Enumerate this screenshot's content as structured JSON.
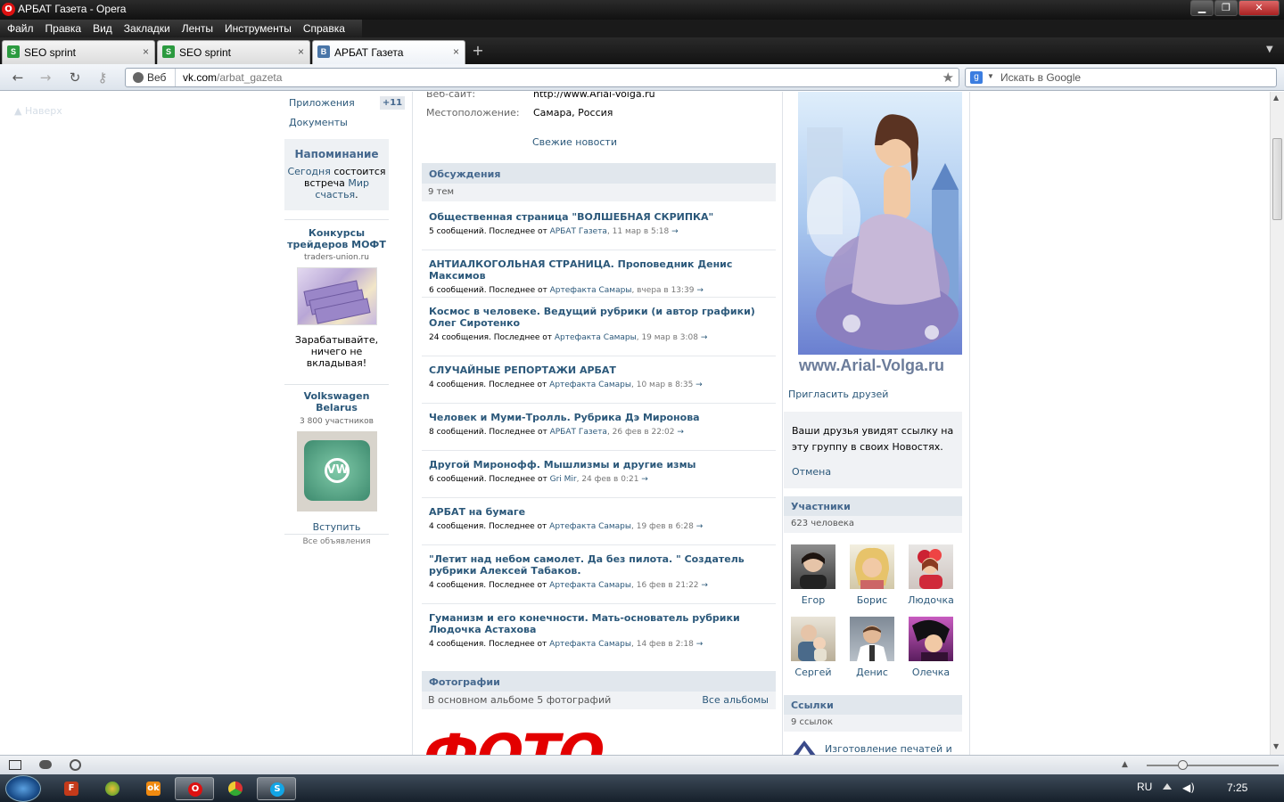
{
  "window": {
    "title": "АРБАТ Газета - Opera",
    "minimize": "▁",
    "maximize": "❐",
    "close": "✕"
  },
  "menu": [
    "Файл",
    "Правка",
    "Вид",
    "Закладки",
    "Ленты",
    "Инструменты",
    "Справка"
  ],
  "tabs": [
    {
      "label": "SEO sprint",
      "icon": "S",
      "color": "#2b9a3f"
    },
    {
      "label": "SEO sprint",
      "icon": "S",
      "color": "#2b9a3f"
    },
    {
      "label": "АРБАТ Газета",
      "icon": "В",
      "color": "#4a76a8"
    }
  ],
  "tab_close": "×",
  "tab_new": "+",
  "tab_menu": "▼",
  "toolbar": {
    "back": "←",
    "forward": "→",
    "reload": "↻",
    "key": "⚷"
  },
  "address": {
    "web_label": "Веб",
    "url_host": "vk.com",
    "url_path": "/arbat_gazeta",
    "star": "★"
  },
  "search": {
    "engine_letter": "g",
    "dropdown": "▼",
    "placeholder": "Искать в Google"
  },
  "left": {
    "to_top": "▲ Наверх",
    "nav": [
      {
        "label": "Приложения",
        "badge": "+11"
      },
      {
        "label": "Документы"
      }
    ],
    "reminder": {
      "title": "Напоминание",
      "line1_link": "Сегодня",
      "line1_rest": " состоится",
      "line2": "встреча ",
      "line2_link": "Мир",
      "line3_link": "счастья",
      "line3_rest": "."
    },
    "ad1": {
      "title": "Конкурсы трейдеров МОФТ",
      "domain": "traders-union.ru",
      "text": "Зарабатывайте, ничего не вкладывая!"
    },
    "ad2": {
      "title": "Volkswagen Belarus",
      "members": "3 800 участников",
      "join": "Вступить"
    },
    "all_ads": "Все объявления"
  },
  "info": {
    "website_label": "Веб-сайт:",
    "website": "http://www.Arial-Volga.ru",
    "location_label": "Местоположение:",
    "location": "Самара, Россия",
    "fresh_news": "Свежие новости"
  },
  "discussions": {
    "title": "Обсуждения",
    "count": "9 тем",
    "topics": [
      {
        "title": "Общественная страница \"ВОЛШЕБНАЯ СКРИПКА\"",
        "count": "5 сообщений. Последнее от ",
        "by": "АРБАТ Газета",
        "date": ", 11 мар в 5:18"
      },
      {
        "title": "АНТИАЛКОГОЛЬНАЯ СТРАНИЦА. Проповедник Денис Максимов",
        "count": "6 сообщений. Последнее от ",
        "by": "Артефакта Самары",
        "date": ", вчера в 13:39"
      },
      {
        "title": "Космос в человеке. Ведущий рубрики (и автор графики) Олег Сиротенко",
        "count": "24 сообщения. Последнее от ",
        "by": "Артефакта Самары",
        "date": ", 19 мар в 3:08"
      },
      {
        "title": "СЛУЧАЙНЫЕ РЕПОРТАЖИ АРБАТ",
        "count": "4 сообщения. Последнее от ",
        "by": "Артефакта Самары",
        "date": ", 10 мар в 8:35"
      },
      {
        "title": "Человек и Муми-Тролль. Рубрика Дэ Миронова",
        "count": "8 сообщений. Последнее от ",
        "by": "АРБАТ Газета",
        "date": ", 26 фев в 22:02"
      },
      {
        "title": "Другой Миронофф. Мышлизмы и другие измы",
        "count": "6 сообщений. Последнее от ",
        "by": "Gri Mir",
        "date": ", 24 фев в 0:21"
      },
      {
        "title": "АРБАТ на бумаге",
        "count": "4 сообщения. Последнее от ",
        "by": "Артефакта Самары",
        "date": ", 19 фев в 6:28"
      },
      {
        "title": "\"Летит над небом самолет. Да без пилота. \" Создатель рубрики Алексей Табаков.",
        "count": "4 сообщения. Последнее от ",
        "by": "Артефакта Самары",
        "date": ", 16 фев в 21:22"
      },
      {
        "title": "Гуманизм и его конечности. Мать-основатель рубрики Людочка Астахова",
        "count": "4 сообщения. Последнее от ",
        "by": "Артефакта Самары",
        "date": ", 14 фев в 2:18"
      }
    ],
    "arrow": "→"
  },
  "photos": {
    "title": "Фотографии",
    "subtitle": "В основном альбоме 5 фотографий",
    "all_albums": "Все альбомы",
    "preview_text": "ФОТО"
  },
  "right": {
    "banner_site": "www.Arial-Volga.ru",
    "invite": "Пригласить друзей",
    "invite_box_text": "Ваши друзья увидят ссылку на эту группу в своих Новостях.",
    "cancel": "Отмена",
    "members_title": "Участники",
    "members_count": "623 человека",
    "members": [
      "Егор",
      "Борис",
      "Людочка",
      "Сергей",
      "Денис",
      "Олечка"
    ],
    "links_title": "Ссылки",
    "links_count": "9 ссылок",
    "link1": "Изготовление печатей и"
  },
  "status": {
    "keyboard_lang": "RU",
    "clock": "7:25"
  },
  "colors": {
    "vk_link": "#2b587a",
    "vk_header_bg": "#e1e7ed",
    "vk_header_text": "#45688e"
  }
}
